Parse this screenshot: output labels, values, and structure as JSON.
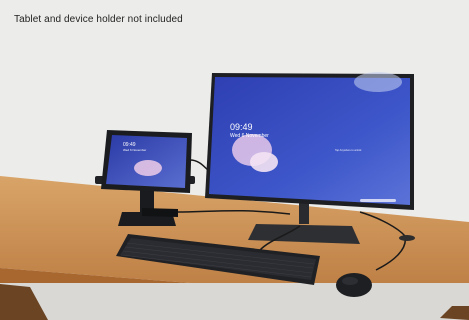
{
  "caption": "Tablet and device holder not included",
  "monitor_screen": {
    "time": "09:49",
    "date": "Wed 6 November",
    "notice": "Tap Anywhere to unlock"
  },
  "tablet_screen": {
    "time": "09:49",
    "date": "Wed 6 November"
  },
  "colors": {
    "wall": "#ececea",
    "desk": "#c88f55",
    "screen_blue": "#3a4bbd",
    "device_black": "#222326"
  }
}
